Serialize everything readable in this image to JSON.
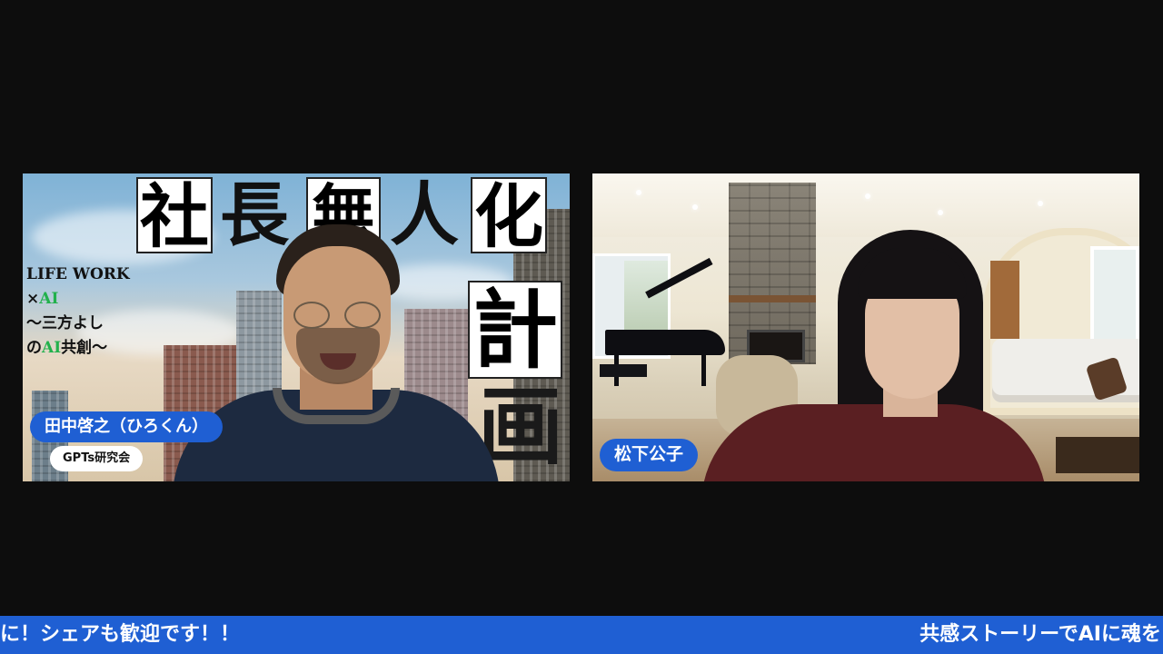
{
  "participants": [
    {
      "name": "田中啓之（ひろくん）",
      "organization": "GPTs研究会",
      "background": {
        "title_chars_top": [
          "社",
          "長",
          "無",
          "人",
          "化"
        ],
        "title_chars_right": [
          "計",
          "画"
        ],
        "side_text": {
          "line1": "LIFE WORK",
          "line2_prefix": "×",
          "line2_ai": "AI",
          "line3": "～三方よし",
          "line4_prefix": "の",
          "line4_ai": "AI",
          "line4_suffix": "共創～"
        }
      }
    },
    {
      "name": "松下公子"
    }
  ],
  "ticker": {
    "left_text": "に！シェアも歓迎です！！",
    "right_text": "共感ストーリーでAIに魂を"
  },
  "colors": {
    "name_tag_blue": "#1f5fd3",
    "ticker_blue": "#1f5fd3",
    "ai_green": "#22b14c",
    "background": "#0d0d0d"
  }
}
